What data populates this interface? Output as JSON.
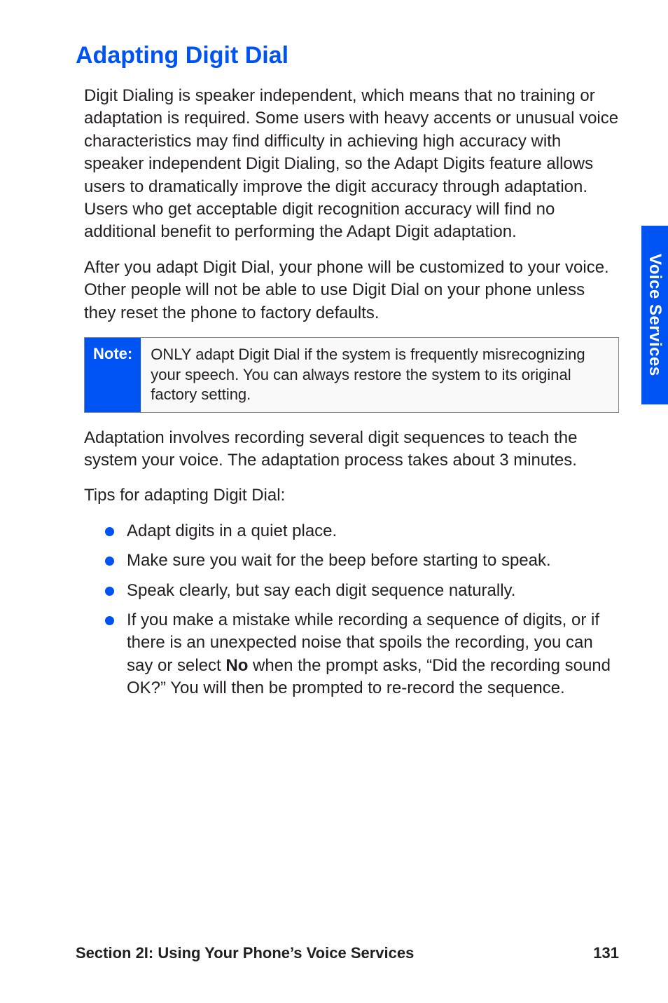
{
  "heading": "Adapting Digit Dial",
  "para1": "Digit Dialing is speaker independent, which means that no training or adaptation is required. Some users with heavy accents or unusual voice characteristics may find difficulty in achieving high accuracy with speaker independent Digit Dialing, so the Adapt Digits feature allows users to dramatically improve the digit accuracy through adaptation. Users who get acceptable digit recognition accuracy will find no additional benefit to performing the Adapt Digit adaptation.",
  "para2": "After you adapt Digit Dial, your phone will be customized to your voice. Other people will not be able to use Digit Dial on your phone unless they reset the phone to factory defaults.",
  "note": {
    "label": "Note:",
    "content": "ONLY adapt Digit Dial if the system is frequently misrecognizing your speech. You can always restore the system to its original factory setting."
  },
  "para3": "Adaptation involves recording several digit sequences to teach the system your voice. The adaptation process takes about 3 minutes.",
  "para4": "Tips for adapting Digit Dial:",
  "list": [
    "Adapt digits in a quiet place.",
    "Make sure you wait for the beep before starting to speak.",
    "Speak clearly, but say each digit sequence naturally."
  ],
  "list4_pre": "If you make a mistake while recording a sequence of digits, or if there is an unexpected noise that spoils the recording, you can say or select ",
  "list4_bold": "No",
  "list4_post": " when the prompt asks, “Did the recording sound OK?” You will then be prompted to re-record the sequence.",
  "sideTab": "Voice Services",
  "footer": {
    "section": "Section 2I: Using Your Phone’s Voice Services",
    "page": "131"
  }
}
